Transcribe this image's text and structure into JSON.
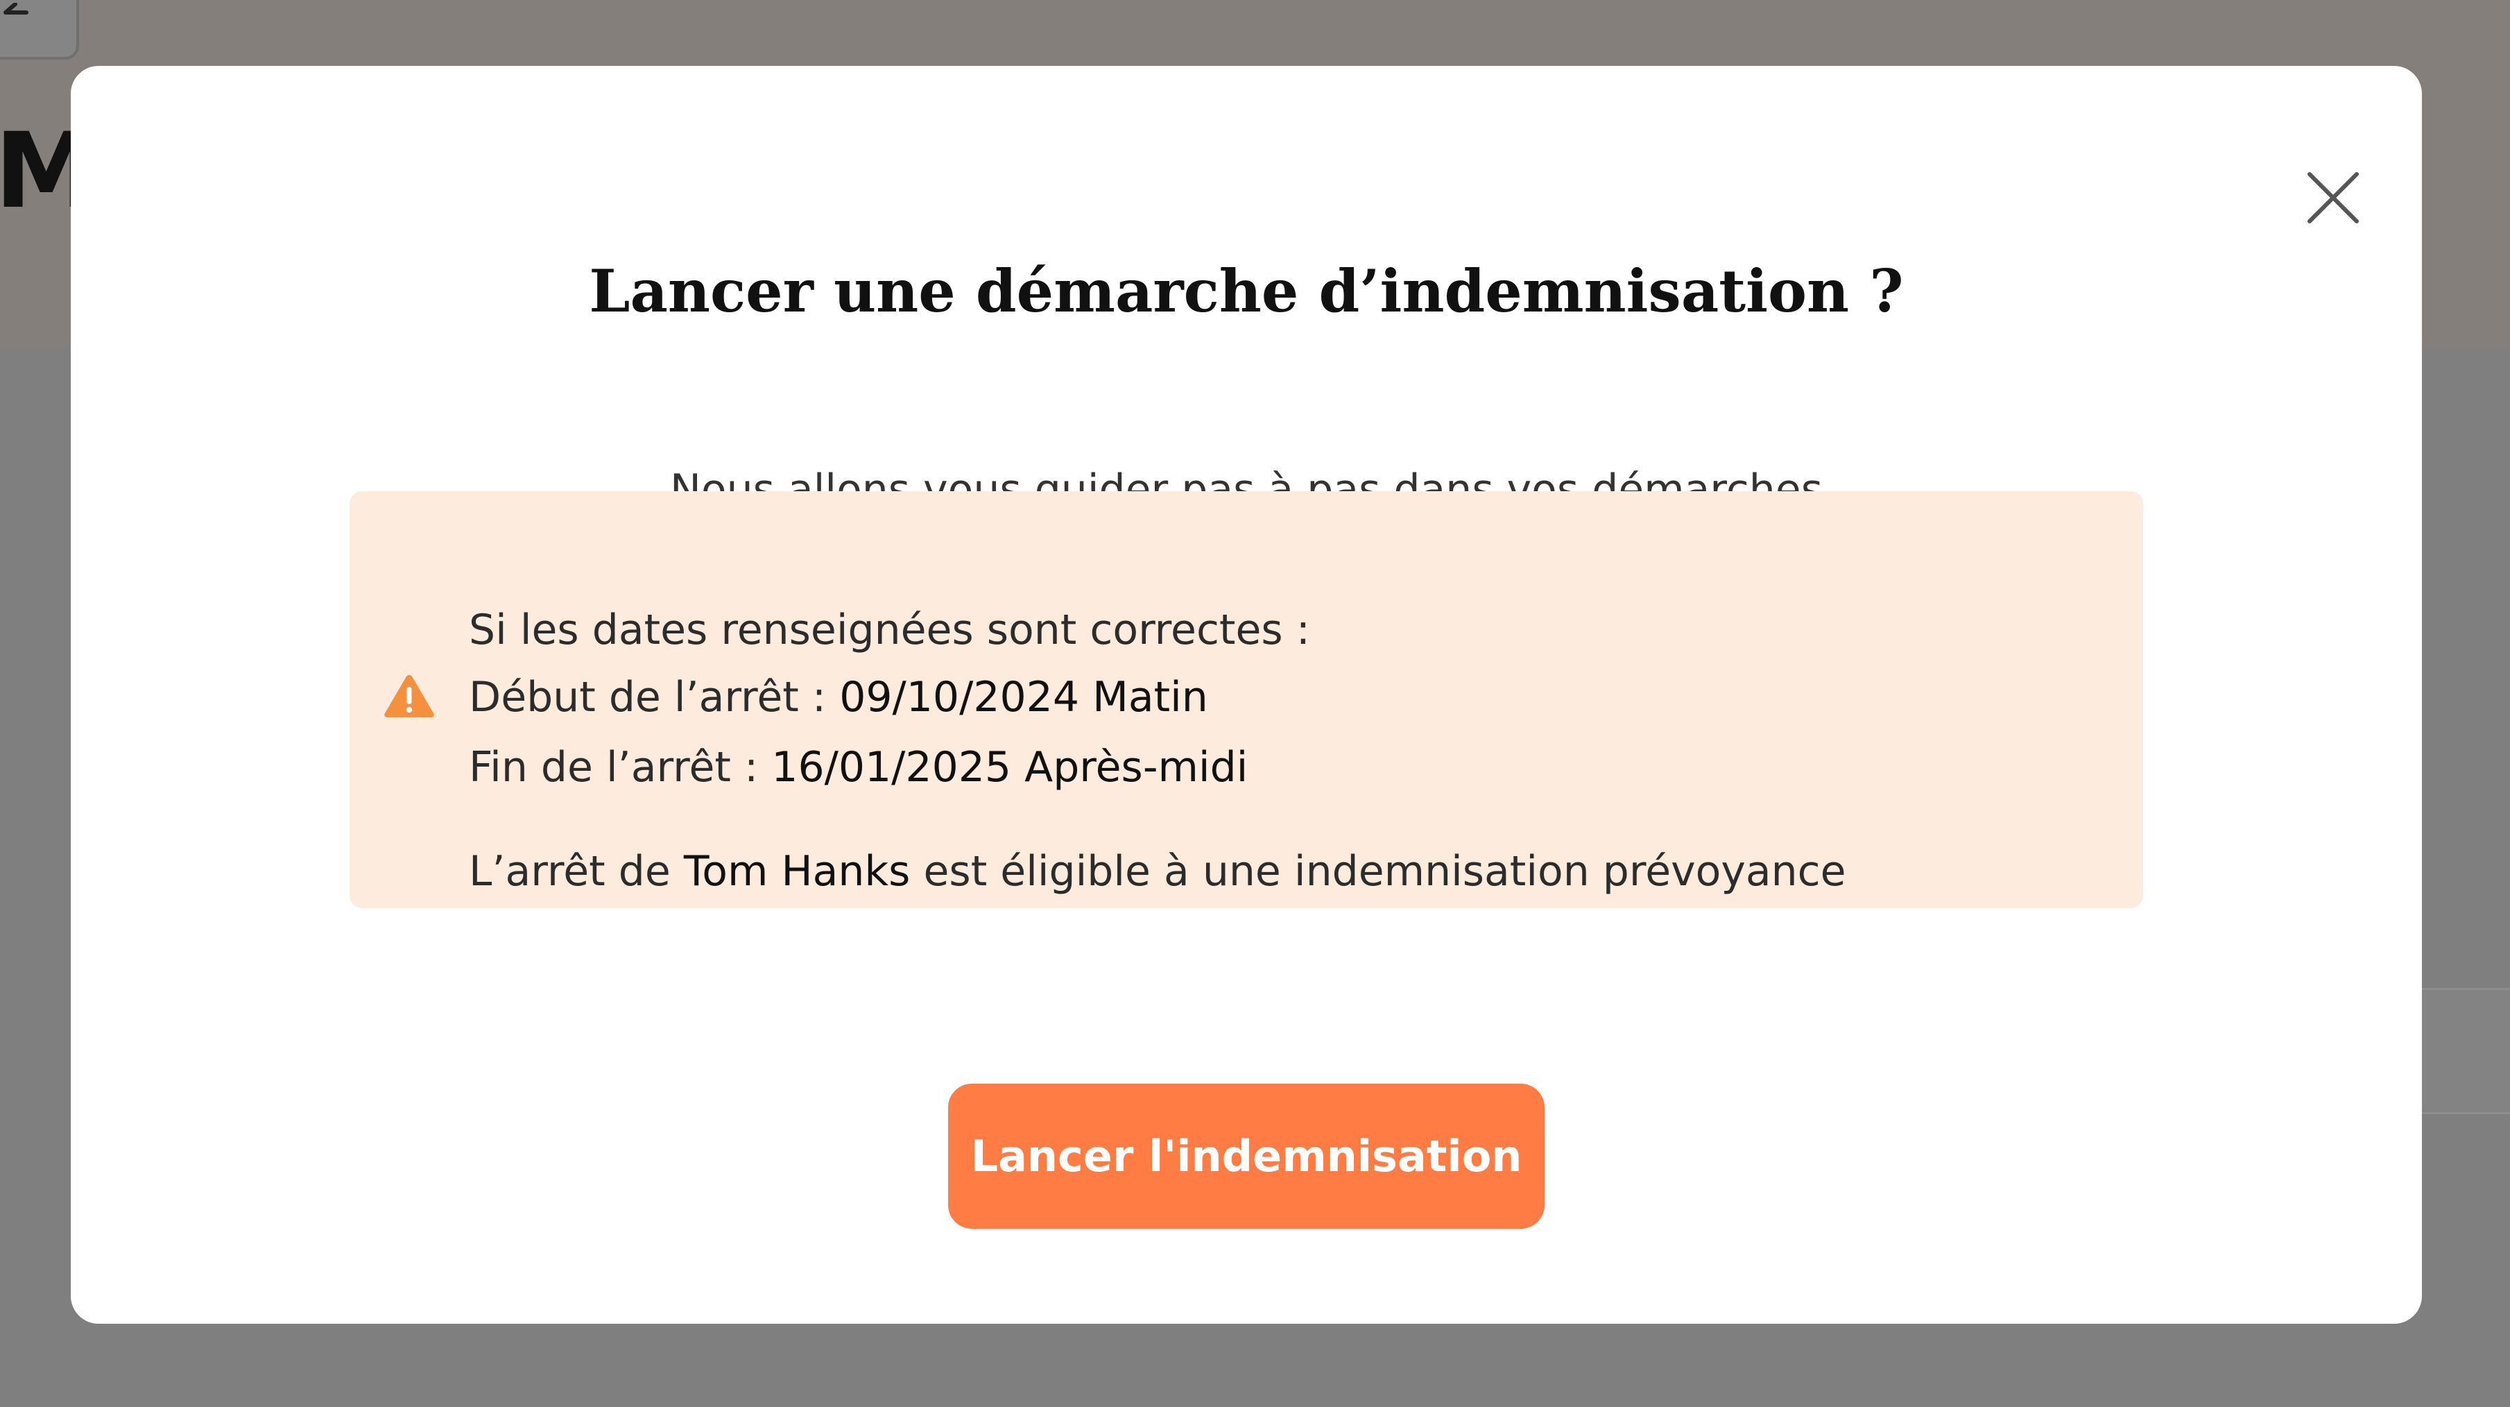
{
  "background": {
    "page_title_fragment": "Mo"
  },
  "modal": {
    "title": "Lancer une démarche d’indemnisation ?",
    "subtitle": "Nous allons vous guider pas à pas dans vos démarches",
    "close_icon": "close-icon",
    "info": {
      "icon": "warning-icon",
      "intro": "Si les dates renseignées sont correctes :",
      "start_label": "Début de l’arrêt :",
      "start_value": "09/10/2024 Matin",
      "end_label": "Fin de l’arrêt :",
      "end_value": "16/01/2025 Après-midi",
      "eligibility_prefix": "L’arrêt de",
      "employee_name": "Tom Hanks",
      "eligibility_suffix": "est éligible à une indemnisation prévoyance"
    },
    "primary_button_label": "Lancer l'indemnisation"
  },
  "colors": {
    "accent": "#ff7c44",
    "info_background": "#fdecdd",
    "warning": "#f5913e",
    "overlay": "#7f7f7f"
  }
}
